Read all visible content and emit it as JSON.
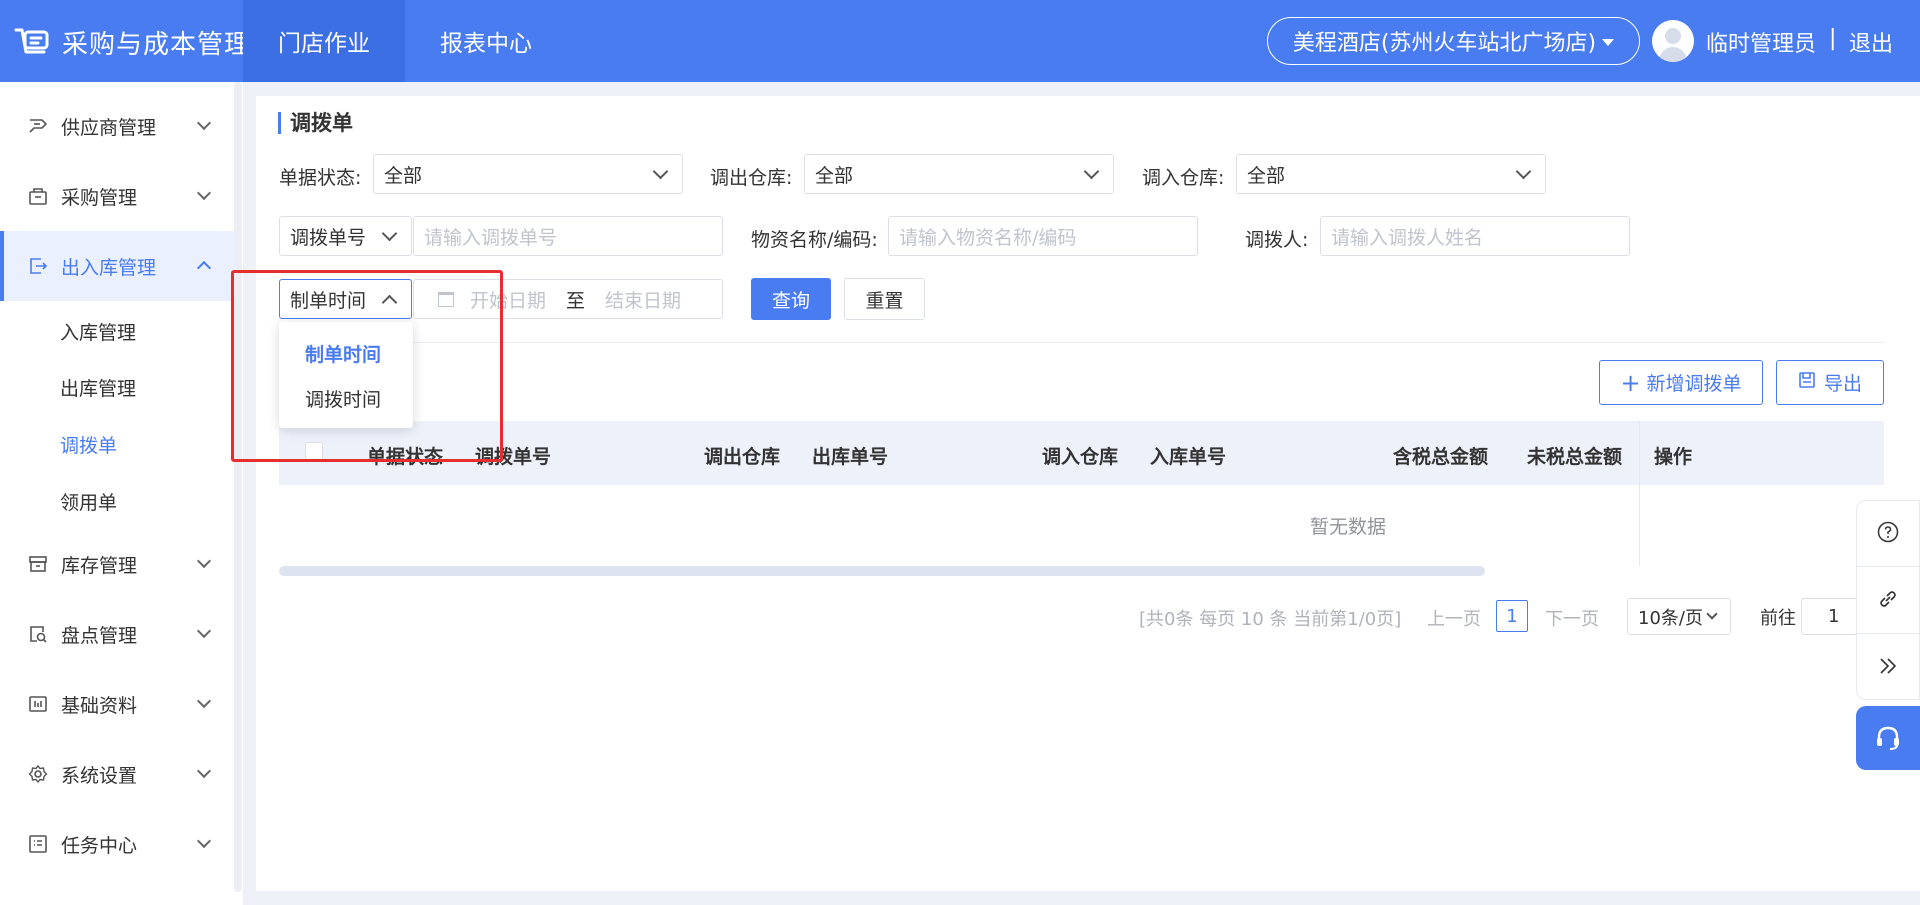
{
  "header": {
    "app_title": "采购与成本管理",
    "nav": [
      {
        "label": "门店作业",
        "active": true
      },
      {
        "label": "报表中心",
        "active": false
      }
    ],
    "store_selector": "美程酒店(苏州火车站北广场店)",
    "user_name": "临时管理员",
    "separator": "|",
    "logout": "退出"
  },
  "sidebar": {
    "items": [
      {
        "label": "供应商管理",
        "icon": "supplier-icon"
      },
      {
        "label": "采购管理",
        "icon": "purchase-icon"
      },
      {
        "label": "出入库管理",
        "icon": "warehouse-io-icon",
        "expanded": true
      },
      {
        "label": "库存管理",
        "icon": "inventory-icon"
      },
      {
        "label": "盘点管理",
        "icon": "stocktake-icon"
      },
      {
        "label": "基础资料",
        "icon": "basic-data-icon"
      },
      {
        "label": "系统设置",
        "icon": "settings-icon"
      },
      {
        "label": "任务中心",
        "icon": "task-icon"
      }
    ],
    "sub_items": [
      {
        "label": "入库管理",
        "active": false
      },
      {
        "label": "出库管理",
        "active": false
      },
      {
        "label": "调拨单",
        "active": true
      },
      {
        "label": "领用单",
        "active": false
      }
    ]
  },
  "page": {
    "title": "调拨单",
    "filters": {
      "status_label": "单据状态:",
      "status_value": "全部",
      "out_wh_label": "调出仓库:",
      "out_wh_value": "全部",
      "in_wh_label": "调入仓库:",
      "in_wh_value": "全部",
      "code_type_value": "调拨单号",
      "code_placeholder": "请输入调拨单号",
      "material_label": "物资名称/编码:",
      "material_placeholder": "请输入物资名称/编码",
      "person_label": "调拨人:",
      "person_placeholder": "请输入调拨人姓名",
      "time_type_value": "制单时间",
      "start_placeholder": "开始日期",
      "range_sep": "至",
      "end_placeholder": "结束日期",
      "query_button": "查询",
      "reset_button": "重置"
    },
    "time_dropdown": {
      "options": [
        "制单时间",
        "调拨时间"
      ],
      "selected": "制单时间"
    },
    "actions": {
      "add_button": "新增调拨单",
      "export_button": "导出"
    },
    "table": {
      "columns": [
        "单据状态",
        "调拨单号",
        "调出仓库",
        "出库单号",
        "调入仓库",
        "入库单号",
        "含税总金额",
        "未税总金额",
        "操作"
      ],
      "empty_text": "暂无数据"
    },
    "pagination": {
      "summary": "[共0条 每页 10 条 当前第1/0页]",
      "prev": "上一页",
      "current_page": "1",
      "next": "下一页",
      "page_size": "10条/页",
      "goto_label": "前往",
      "goto_value": "1"
    }
  },
  "colors": {
    "brand": "#4a7cf1",
    "highlight_box": "#e52e2e"
  }
}
